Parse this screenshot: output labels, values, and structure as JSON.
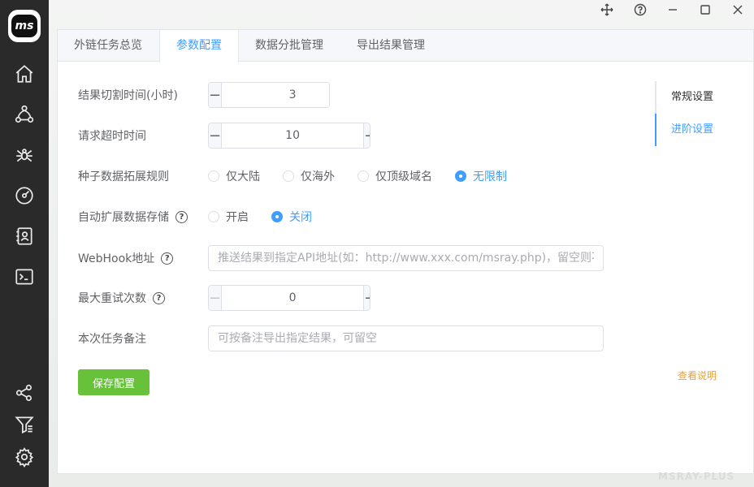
{
  "app": {
    "logo_text": "ms",
    "watermark": "MSRAY-PLUS"
  },
  "sidebar": {
    "items": [
      {
        "icon": "home-icon"
      },
      {
        "icon": "network-icon"
      },
      {
        "icon": "spider-icon"
      },
      {
        "icon": "gauge-icon"
      },
      {
        "icon": "contacts-icon"
      },
      {
        "icon": "terminal-icon"
      },
      {
        "icon": "share-icon"
      },
      {
        "icon": "filter-icon"
      },
      {
        "icon": "gear-icon"
      }
    ]
  },
  "window_controls": [
    "move-icon",
    "help-icon",
    "minimize-icon",
    "maximize-icon",
    "close-icon"
  ],
  "tabs": [
    {
      "label": "外链任务总览",
      "active": false
    },
    {
      "label": "参数配置",
      "active": true
    },
    {
      "label": "数据分批管理",
      "active": false
    },
    {
      "label": "导出结果管理",
      "active": false
    }
  ],
  "form": {
    "cut_time": {
      "label": "结果切割时间(小时)",
      "value": "3"
    },
    "timeout": {
      "label": "请求超时时间",
      "value": "10"
    },
    "seed_rule": {
      "label": "种子数据拓展规则",
      "options": [
        "仅大陆",
        "仅海外",
        "仅顶级域名",
        "无限制"
      ],
      "selected": "无限制"
    },
    "auto_store": {
      "label": "自动扩展数据存储",
      "options": [
        "开启",
        "关闭"
      ],
      "selected": "关闭"
    },
    "webhook": {
      "label": "WebHook地址",
      "value": "",
      "placeholder": "推送结果到指定API地址(如：http://www.xxx.com/msray.php)，留空则不"
    },
    "retry": {
      "label": "最大重试次数",
      "value": "0"
    },
    "note": {
      "label": "本次任务备注",
      "value": "",
      "placeholder": "可按备注导出指定结果，可留空"
    },
    "save_label": "保存配置",
    "help_label": "查看说明"
  },
  "anchors": [
    {
      "label": "常规设置",
      "active": false
    },
    {
      "label": "进阶设置",
      "active": true
    }
  ],
  "colors": {
    "accent": "#409eff",
    "success": "#67c23a",
    "warning": "#e6a23c",
    "sidebar": "#2a2a2a"
  }
}
